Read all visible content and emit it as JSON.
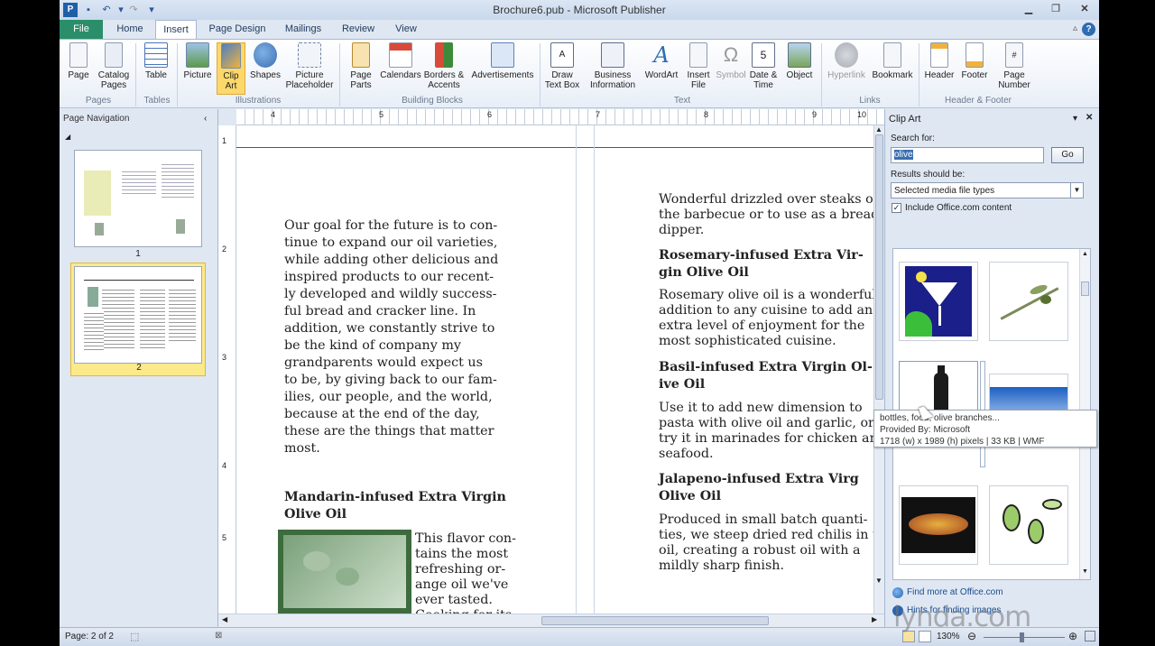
{
  "window": {
    "title": "Brochure6.pub - Microsoft Publisher"
  },
  "tabs": [
    "File",
    "Home",
    "Insert",
    "Page Design",
    "Mailings",
    "Review",
    "View"
  ],
  "ribbon": {
    "pages": {
      "page": "Page",
      "catalog": "Catalog Pages",
      "group": "Pages"
    },
    "tables": {
      "table": "Table",
      "group": "Tables"
    },
    "illustrations": {
      "picture": "Picture",
      "clipart": "Clip Art",
      "shapes": "Shapes",
      "placeholder": "Picture Placeholder",
      "group": "Illustrations"
    },
    "building_blocks": {
      "page_parts": "Page Parts",
      "calendars": "Calendars",
      "borders": "Borders & Accents",
      "ads": "Advertisements",
      "group": "Building Blocks"
    },
    "text": {
      "draw_text_box": "Draw Text Box",
      "business_info": "Business Information",
      "wordart": "WordArt",
      "insert_file": "Insert File",
      "symbol": "Symbol",
      "date_time": "Date & Time",
      "object": "Object",
      "group": "Text"
    },
    "links": {
      "hyperlink": "Hyperlink",
      "bookmark": "Bookmark",
      "group": "Links"
    },
    "header_footer": {
      "header": "Header",
      "footer": "Footer",
      "page_number": "Page Number",
      "group": "Header & Footer"
    }
  },
  "nav": {
    "title": "Page Navigation",
    "pages": [
      "1",
      "2"
    ]
  },
  "ruler": {
    "h": [
      "4",
      "5",
      "6",
      "7",
      "8",
      "9",
      "10"
    ],
    "v": [
      "1",
      "2",
      "3",
      "4",
      "5"
    ]
  },
  "document": {
    "left_para": [
      "Our goal for the future is to con-",
      "tinue to expand our oil varieties,",
      "while adding other delicious and",
      "inspired products to our recent-",
      "ly developed and wildly success-",
      "ful bread and cracker line. In",
      "addition, we constantly strive to",
      "be the kind of company my",
      "grandparents would expect us",
      "to be, by giving back to our fam-",
      "ilies, our people, and the world,",
      "because at the end of the day,",
      "these are the things that matter",
      "most."
    ],
    "mandarin_heading": [
      "Mandarin-infused Extra Virgin",
      "Olive Oil"
    ],
    "mandarin_text": [
      "This flavor con-",
      "tains the most",
      "refreshing or-",
      "ange oil we've",
      "ever tasted.",
      "Cooking for its"
    ],
    "right_intro": [
      "Wonderful drizzled over steaks or",
      "the barbecue or to use as a bread",
      "dipper."
    ],
    "rosemary_heading": [
      "Rosemary-infused Extra Vir-",
      "gin Olive Oil"
    ],
    "rosemary_text": [
      "Rosemary olive oil is a wonderful",
      "addition to any cuisine to add an",
      "extra level of enjoyment for the",
      "most sophisticated cuisine."
    ],
    "basil_heading": [
      "Basil-infused Extra Virgin Ol-",
      "ive Oil"
    ],
    "basil_text": [
      "Use it to add new dimension to",
      "pasta with olive oil and garlic, or",
      "try it in marinades for chicken an",
      "seafood."
    ],
    "jalapeno_heading": [
      "Jalapeno-infused Extra Virg",
      "Olive Oil"
    ],
    "jalapeno_text": [
      "Produced in small batch quanti-",
      "ties, we steep dried red chilis in t",
      "oil, creating a robust oil with a",
      "mildly sharp finish."
    ]
  },
  "clipart": {
    "title": "Clip Art",
    "search_label": "Search for:",
    "search_value": "olive",
    "go": "Go",
    "results_label": "Results should be:",
    "results_value": "Selected media file types",
    "include_label": "Include Office.com content",
    "include_checked": true,
    "find_more": "Find more at Office.com",
    "hints": "Hints for finding images",
    "tooltip": {
      "line1": "bottles, food, olive branches...",
      "line2": "Provided By: Microsoft",
      "line3": "1718 (w) x 1989 (h) pixels | 33 KB | WMF"
    }
  },
  "status": {
    "page": "Page: 2 of 2",
    "zoom": "130%"
  },
  "watermark": "lynda.com"
}
